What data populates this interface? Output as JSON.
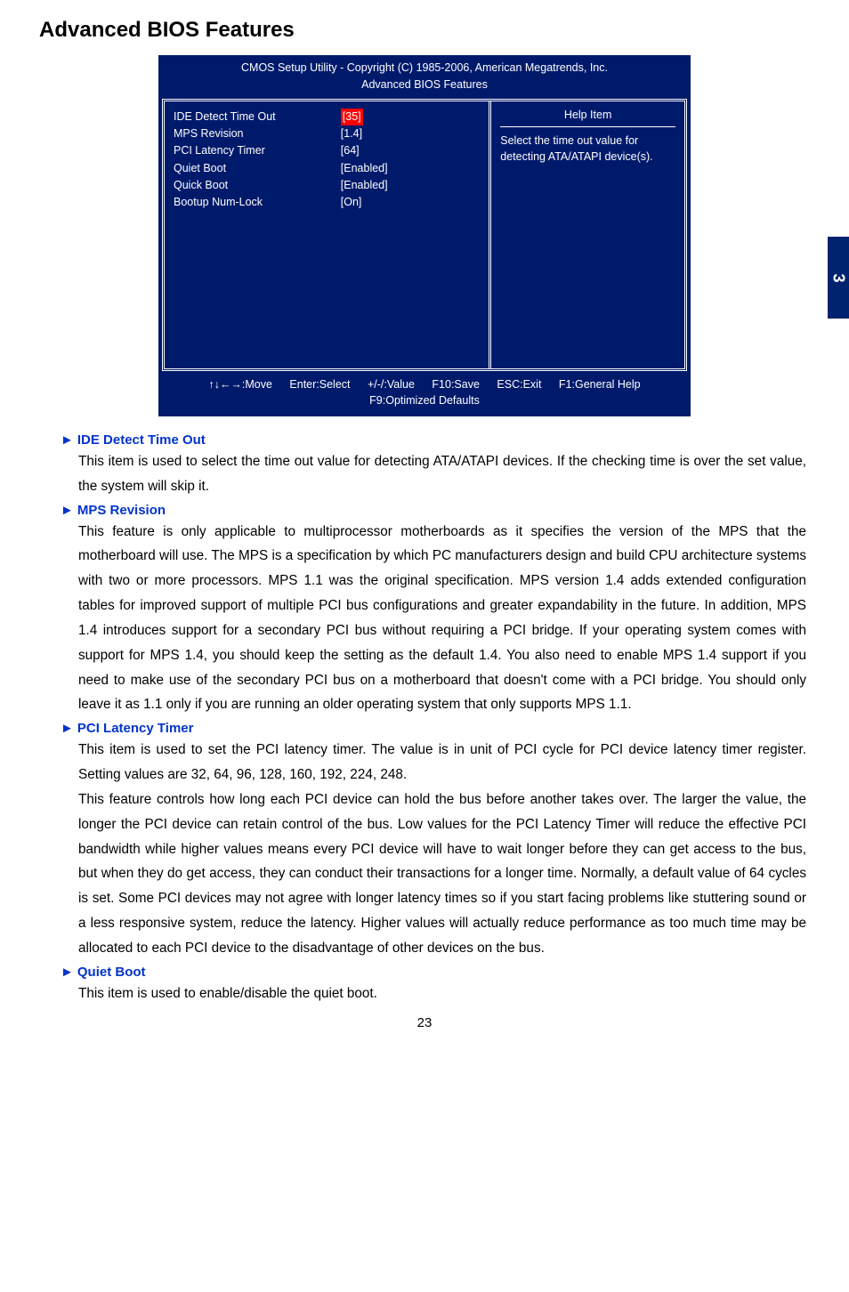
{
  "page_title": "Advanced BIOS Features",
  "side_tab": "3",
  "page_number": "23",
  "bios": {
    "header_line1": "CMOS Setup Utility - Copyright (C) 1985-2006, American Megatrends, Inc.",
    "header_line2": "Advanced BIOS Features",
    "rows": [
      {
        "label": "IDE Detect Time Out",
        "value": "[35]",
        "selected": true
      },
      {
        "label": "MPS Revision",
        "value": "[1.4]",
        "selected": false
      },
      {
        "label": "PCI Latency Timer",
        "value": "[64]",
        "selected": false
      },
      {
        "label": "Quiet Boot",
        "value": "[Enabled]",
        "selected": false
      },
      {
        "label": "Quick Boot",
        "value": "[Enabled]",
        "selected": false
      },
      {
        "label": "Bootup Num-Lock",
        "value": "[On]",
        "selected": false
      }
    ],
    "help_title": "Help Item",
    "help_body": "Select the time out value for detecting ATA/ATAPI device(s).",
    "footer": {
      "move": "↑↓←→:Move",
      "enter": "Enter:Select",
      "value": "+/-/:Value",
      "save": "F10:Save",
      "exit": "ESC:Exit",
      "general": "F1:General Help",
      "defaults": "F9:Optimized Defaults"
    }
  },
  "items": [
    {
      "title": "IDE Detect Time Out",
      "body": "This item is used to select the time out value for detecting ATA/ATAPI devices. If the checking time is over the set value, the system will skip it."
    },
    {
      "title": "MPS Revision",
      "body": "This feature is only applicable to multiprocessor motherboards as it specifies the version of the MPS that the motherboard will use. The MPS is a specification by which PC manufacturers design and build CPU architecture systems with two or more processors. MPS 1.1 was the original specification. MPS version 1.4 adds extended configuration tables for improved support of multiple PCI bus configurations and greater expandability in the future. In addition, MPS 1.4 introduces support for a secondary PCI bus without requiring a PCI bridge. If your operating system comes with support for MPS 1.4, you should keep the setting as the default 1.4. You also need to enable MPS 1.4 support if you need to make use of the secondary PCI bus on a motherboard that doesn't come with a PCI bridge. You should only leave it as 1.1 only if you are running an older operating system that only supports MPS 1.1."
    },
    {
      "title": "PCI Latency Timer",
      "body": "This item is used to set the PCI latency timer. The value is in unit of PCI cycle for PCI device latency timer register. Setting values are 32, 64, 96, 128, 160, 192, 224, 248.\nThis feature controls how long each PCI device can hold the bus before another takes over. The larger the value, the longer the PCI device can retain control of the bus. Low values for the PCI Latency Timer will reduce the effective PCI bandwidth while higher values means every PCI device will have to wait longer before they can get access to the bus, but when they do get access, they can conduct their transactions for a longer time. Normally, a default value of 64 cycles is set. Some PCI devices may not agree with longer latency times so if you start facing problems like stuttering sound or a less responsive system, reduce the latency. Higher values will actually reduce performance as too much time may be allocated to each PCI device to the disadvantage of other devices on the bus."
    },
    {
      "title": "Quiet Boot",
      "body": "This item is used to enable/disable the quiet boot."
    }
  ]
}
